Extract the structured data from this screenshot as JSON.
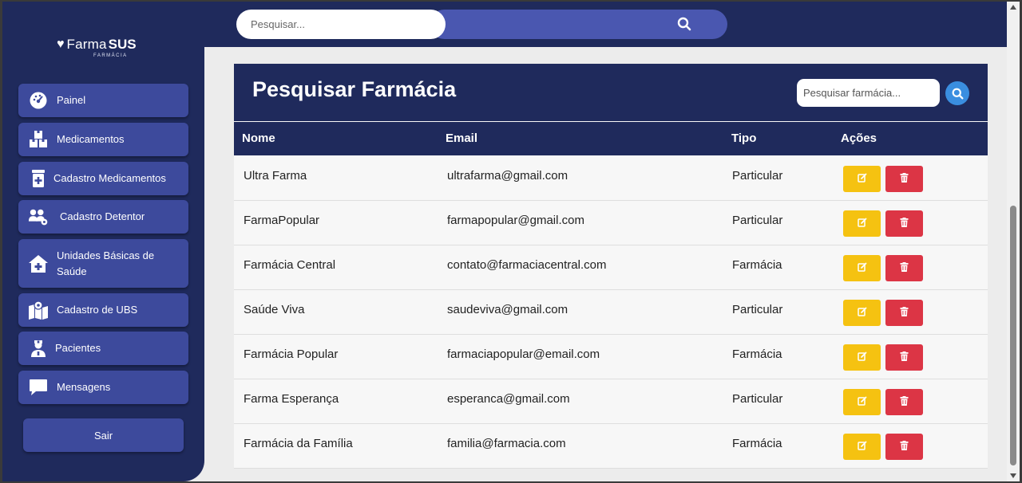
{
  "brand": {
    "name_part1": "Farma",
    "name_part2": "SUS",
    "subtitle": "FARMÁCIA"
  },
  "sidebar": {
    "items": [
      {
        "label": "Painel",
        "icon": "dashboard-gauge-icon"
      },
      {
        "label": "Medicamentos",
        "icon": "boxes-icon"
      },
      {
        "label": "Cadastro Medicamentos",
        "icon": "medicine-bottle-icon"
      },
      {
        "label": "Cadastro Detentor",
        "icon": "users-gear-icon"
      },
      {
        "label": "Unidades Básicas de Saúde",
        "icon": "house-medical-icon"
      },
      {
        "label": "Cadastro de UBS",
        "icon": "map-location-icon"
      },
      {
        "label": "Pacientes",
        "icon": "user-nurse-icon"
      },
      {
        "label": "Mensagens",
        "icon": "message-bubble-icon"
      }
    ],
    "logout_label": "Sair"
  },
  "topbar": {
    "search_placeholder": "Pesquisar..."
  },
  "panel": {
    "title": "Pesquisar Farmácia",
    "search_placeholder": "Pesquisar farmácia..."
  },
  "table": {
    "headers": {
      "name": "Nome",
      "email": "Email",
      "type": "Tipo",
      "actions": "Ações"
    },
    "rows": [
      {
        "name": "Ultra Farma",
        "email": "ultrafarma@gmail.com",
        "type": "Particular"
      },
      {
        "name": "FarmaPopular",
        "email": "farmapopular@gmail.com",
        "type": "Particular"
      },
      {
        "name": "Farmácia Central",
        "email": "contato@farmaciacentral.com",
        "type": "Farmácia"
      },
      {
        "name": "Saúde Viva",
        "email": "saudeviva@gmail.com",
        "type": "Particular"
      },
      {
        "name": "Farmácia Popular",
        "email": "farmaciapopular@email.com",
        "type": "Farmácia"
      },
      {
        "name": "Farma Esperança",
        "email": "esperanca@gmail.com",
        "type": "Particular"
      },
      {
        "name": "Farmácia da Família",
        "email": "familia@farmacia.com",
        "type": "Farmácia"
      }
    ]
  },
  "colors": {
    "navy": "#1f2a5c",
    "nav_button": "#3d4a9c",
    "edit": "#f5c211",
    "delete": "#dc3545",
    "search_button": "#3a8ee0"
  }
}
